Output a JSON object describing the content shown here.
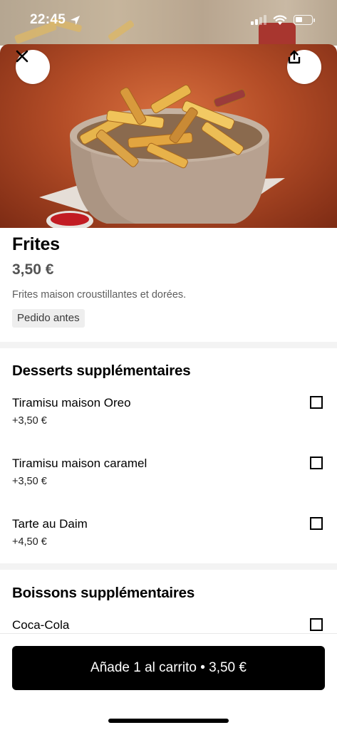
{
  "status_bar": {
    "time": "22:45",
    "icons": [
      "location-arrow-icon",
      "cellular-signal-icon",
      "wifi-icon",
      "battery-icon"
    ]
  },
  "hero": {
    "close_icon": "close-icon",
    "share_icon": "share-icon"
  },
  "product": {
    "title": "Frites",
    "price": "3,50 €",
    "description": "Frites maison croustillantes et dorées.",
    "tag": "Pedido antes"
  },
  "sections": [
    {
      "title": "Desserts supplémentaires",
      "options": [
        {
          "name": "Tiramisu maison Oreo",
          "price": "+3,50 €",
          "checked": false
        },
        {
          "name": "Tiramisu maison caramel",
          "price": "+3,50 €",
          "checked": false
        },
        {
          "name": "Tarte au Daim",
          "price": "+4,50 €",
          "checked": false
        }
      ]
    },
    {
      "title": "Boissons supplémentaires",
      "options": [
        {
          "name": "Coca-Cola",
          "price": "",
          "checked": false
        }
      ]
    }
  ],
  "cart_button": {
    "label": "Añade 1 al carrito • 3,50 €"
  },
  "colors": {
    "accent": "#000000",
    "divider": "#f3f3f3",
    "tag_bg": "#eeeeee",
    "secondary_text": "#545454"
  }
}
